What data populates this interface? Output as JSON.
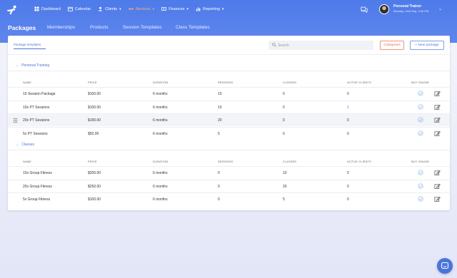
{
  "nav": {
    "items": [
      {
        "label": "Dashboard",
        "icon": "dashboard-icon",
        "caret": false,
        "active": false
      },
      {
        "label": "Calendar",
        "icon": "calendar-icon",
        "caret": false,
        "active": false
      },
      {
        "label": "Clients",
        "icon": "clients-icon",
        "caret": true,
        "active": false
      },
      {
        "label": "Services",
        "icon": "services-icon",
        "caret": true,
        "active": true
      },
      {
        "label": "Finances",
        "icon": "finances-icon",
        "caret": true,
        "active": false
      },
      {
        "label": "Reporting",
        "icon": "reporting-icon",
        "caret": true,
        "active": false
      }
    ]
  },
  "user": {
    "name": "Personal Trainer",
    "date": "Monday, 14th Sep, 4:32 PM"
  },
  "subnav": {
    "title": "Packages",
    "tabs": [
      "Memberships",
      "Products",
      "Session Templates",
      "Class Templates"
    ]
  },
  "card": {
    "tab": "Package templates",
    "search_placeholder": "Search",
    "categories_button": "Categories",
    "new_package_button": "+ New package"
  },
  "columns": [
    "NAME",
    "PRICE",
    "DURATION",
    "SESSIONS",
    "CLASSES",
    "ACTIVE CLIENTS",
    "BUY ONLINE"
  ],
  "groups": [
    {
      "label": "Personal Training",
      "rows": [
        {
          "name": "10 Session Package",
          "price": "$100.00",
          "duration": "6 months",
          "sessions": "10",
          "classes": "0",
          "active_clients": "0"
        },
        {
          "name": "10x PT Sessions",
          "price": "$100.00",
          "duration": "6 months",
          "sessions": "10",
          "classes": "0",
          "active_clients": "1"
        },
        {
          "name": "20x PT Sessions",
          "price": "$190.00",
          "duration": "6 months",
          "sessions": "20",
          "classes": "0",
          "active_clients": "0"
        },
        {
          "name": "5x PT Sessions",
          "price": "$50.00",
          "duration": "6 months",
          "sessions": "5",
          "classes": "0",
          "active_clients": "0"
        }
      ]
    },
    {
      "label": "Classes",
      "rows": [
        {
          "name": "10x Group Fitness",
          "price": "$200.00",
          "duration": "6 months",
          "sessions": "0",
          "classes": "10",
          "active_clients": "0"
        },
        {
          "name": "20x Group Fitness",
          "price": "$250.00",
          "duration": "6 months",
          "sessions": "0",
          "classes": "20",
          "active_clients": "0"
        },
        {
          "name": "5x Group Fitness",
          "price": "$100.00",
          "duration": "6 months",
          "sessions": "0",
          "classes": "5",
          "active_clients": "0"
        }
      ]
    }
  ],
  "colors": {
    "accent": "#4a74d9",
    "nav_active": "#f6b37a",
    "danger": "#e9694f"
  }
}
